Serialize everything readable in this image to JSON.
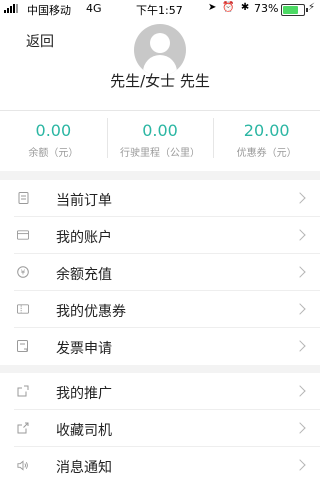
{
  "status_bar": {
    "carrier": "中国移动",
    "network": "4G",
    "time": "下午1:57",
    "battery": "73%",
    "battery_level": 0.73,
    "icons": [
      "location-icon",
      "alarm-icon",
      "bluetooth-icon",
      "charging-icon"
    ]
  },
  "header": {
    "back_label": "返回",
    "username": "先生/女士 先生"
  },
  "stats": [
    {
      "value": "0.00",
      "label": "余额（元）"
    },
    {
      "value": "0.00",
      "label": "行驶里程（公里）"
    },
    {
      "value": "20.00",
      "label": "优惠券（元）"
    }
  ],
  "menu_group1": [
    {
      "label": "当前订单",
      "icon": "order-icon"
    },
    {
      "label": "我的账户",
      "icon": "card-icon"
    },
    {
      "label": "余额充值",
      "icon": "recharge-icon"
    },
    {
      "label": "我的优惠券",
      "icon": "coupon-icon"
    },
    {
      "label": "发票申请",
      "icon": "invoice-icon"
    }
  ],
  "menu_group2": [
    {
      "label": "我的推广",
      "icon": "share-icon"
    },
    {
      "label": "收藏司机",
      "icon": "favorite-icon"
    },
    {
      "label": "消息通知",
      "icon": "speaker-icon"
    }
  ],
  "colors": {
    "accent": "#2bb6a3",
    "icon": "#9a9a9a",
    "divider": "#f3f3f3"
  }
}
